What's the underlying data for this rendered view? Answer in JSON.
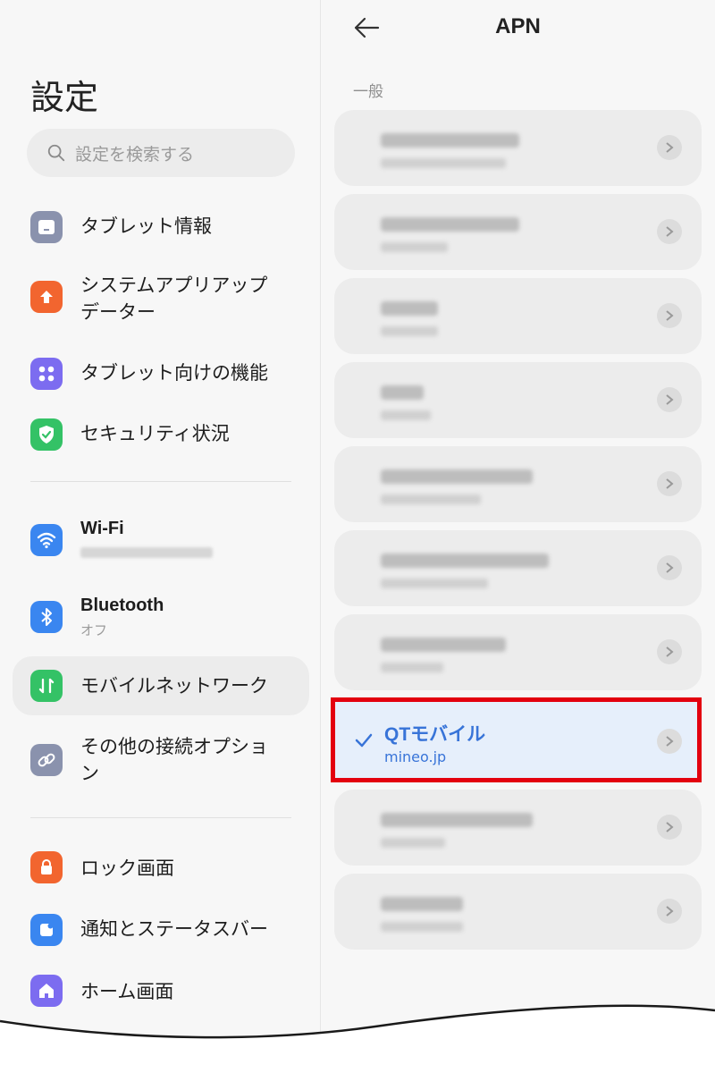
{
  "settings": {
    "title": "設定",
    "search_placeholder": "設定を検索する",
    "items": [
      {
        "label": "タブレット情報",
        "icon": "tablet-icon",
        "color": "#8a92ad"
      },
      {
        "label": "システムアプリアップデーター",
        "icon": "arrow-up-icon",
        "color": "#f2652f"
      },
      {
        "label": "タブレット向けの機能",
        "icon": "dots-grid-icon",
        "color": "#7c6cf0"
      },
      {
        "label": "セキュリティ状況",
        "icon": "shield-check-icon",
        "color": "#34c266"
      },
      {
        "label": "Wi-Fi",
        "icon": "wifi-icon",
        "color": "#3a86f0"
      },
      {
        "label": "Bluetooth",
        "sub": "オフ",
        "icon": "bluetooth-icon",
        "color": "#3a86f0"
      },
      {
        "label": "モバイルネットワーク",
        "icon": "mobile-data-icon",
        "color": "#34c266"
      },
      {
        "label": "その他の接続オプション",
        "icon": "link-icon",
        "color": "#8a92ad"
      },
      {
        "label": "ロック画面",
        "icon": "lock-icon",
        "color": "#f2652f"
      },
      {
        "label": "通知とステータスバー",
        "icon": "notification-icon",
        "color": "#3a86f0"
      },
      {
        "label": "ホーム画面",
        "icon": "home-icon",
        "color": "#7c6cf0"
      }
    ]
  },
  "apn": {
    "title": "APN",
    "section_label": "一般",
    "selected": {
      "name": "QTモバイル",
      "apn": "mineo.jp"
    },
    "accent_color": "#3874d8",
    "highlight_color": "#e3000f"
  }
}
